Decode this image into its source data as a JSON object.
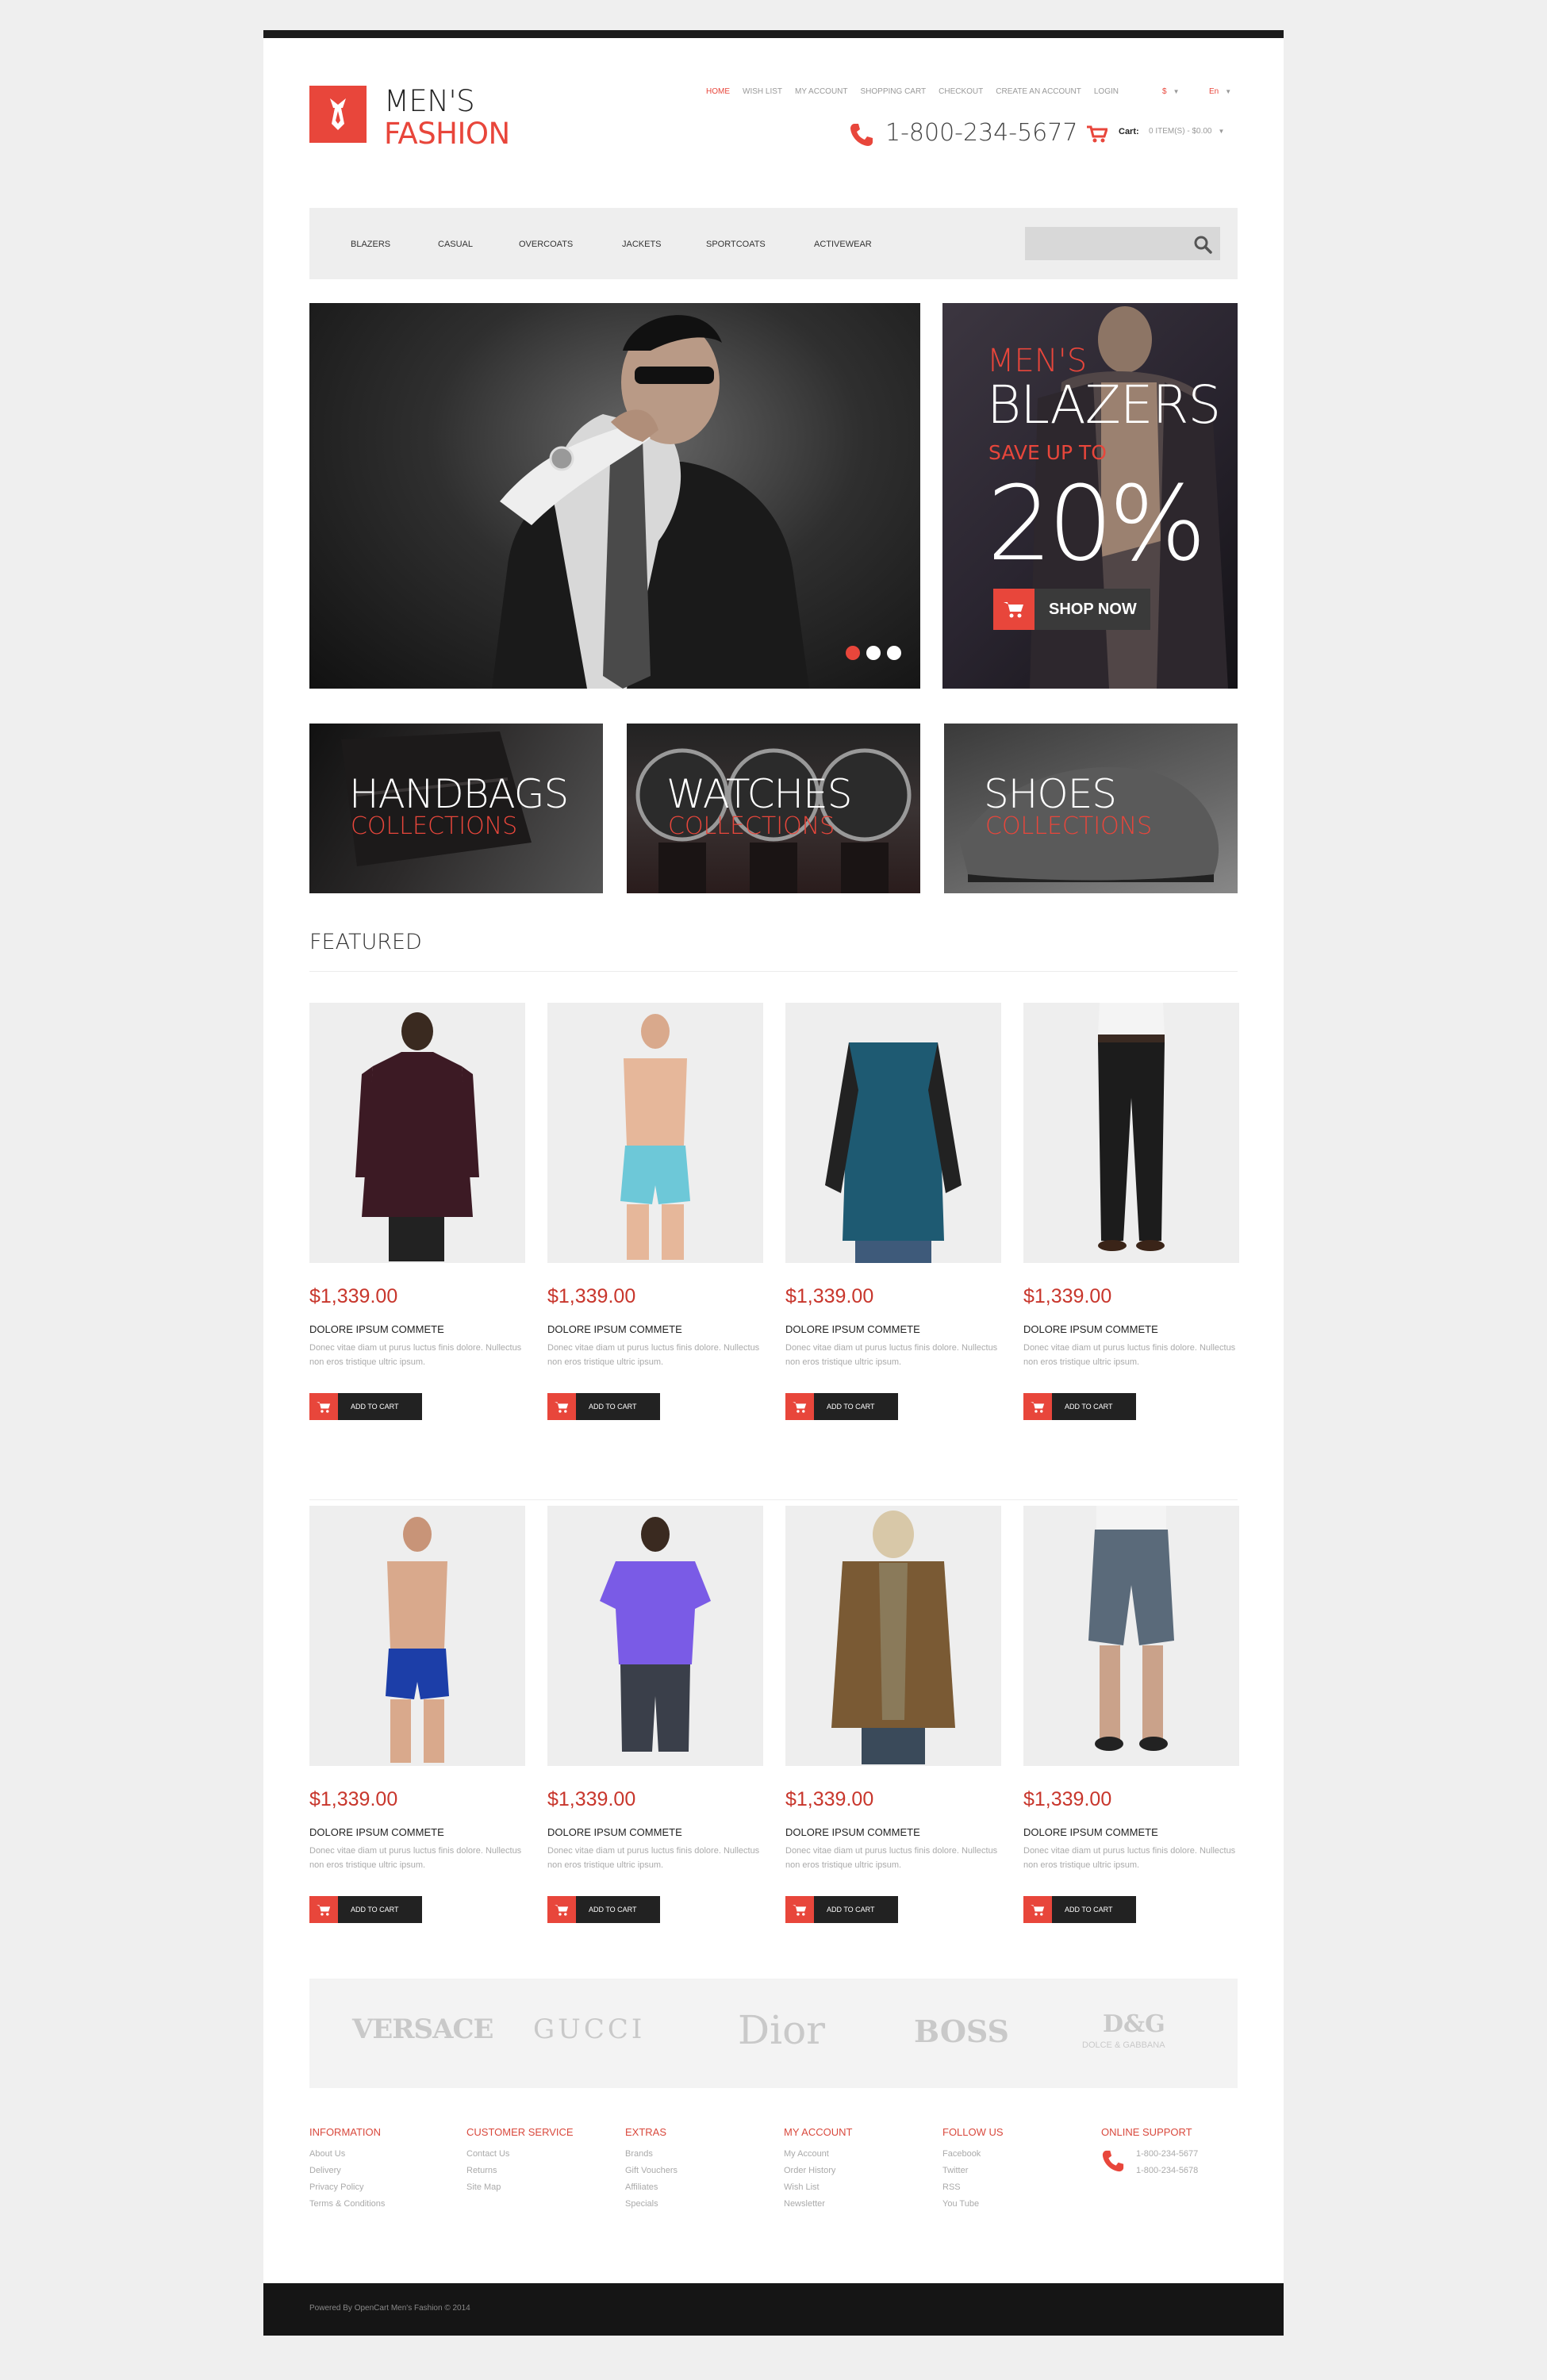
{
  "brand": {
    "line1": "MEN'S",
    "line2": "FASHION"
  },
  "top_links": [
    "HOME",
    "WISH LIST",
    "MY ACCOUNT",
    "SHOPPING CART",
    "CHECKOUT",
    "CREATE AN ACCOUNT",
    "LOGIN"
  ],
  "currency": "$",
  "language": "En",
  "phone": "1-800-234-5677",
  "cart": {
    "label": "Cart:",
    "value": "0 ITEM(S) - $0.00"
  },
  "nav": [
    "BLAZERS",
    "CASUAL",
    "OVERCOATS",
    "JACKETS",
    "SPORTCOATS",
    "ACTIVEWEAR"
  ],
  "search": {
    "placeholder": ""
  },
  "hero": {
    "slides": 3,
    "active_slide": 0
  },
  "promo": {
    "line1": "MEN'S",
    "line2": "BLAZERS",
    "line3": "SAVE UP TO",
    "percent": "20%",
    "button": "SHOP NOW"
  },
  "collections": [
    {
      "title": "HANDBAGS",
      "subtitle": "COLLECTIONS"
    },
    {
      "title": "WATCHES",
      "subtitle": "COLLECTIONS"
    },
    {
      "title": "SHOES",
      "subtitle": "COLLECTIONS"
    }
  ],
  "featured_title": "FEATURED",
  "products": [
    {
      "price": "$1,339.00",
      "name": "DOLORE IPSUM COMMETE",
      "desc": "Donec vitae diam ut purus luctus finis dolore. Nullectus non eros tristique ultric ipsum.",
      "button": "ADD TO CART"
    },
    {
      "price": "$1,339.00",
      "name": "DOLORE IPSUM COMMETE",
      "desc": "Donec vitae diam ut purus luctus finis dolore. Nullectus non eros tristique ultric ipsum.",
      "button": "ADD TO CART"
    },
    {
      "price": "$1,339.00",
      "name": "DOLORE IPSUM COMMETE",
      "desc": "Donec vitae diam ut purus luctus finis dolore. Nullectus non eros tristique ultric ipsum.",
      "button": "ADD TO CART"
    },
    {
      "price": "$1,339.00",
      "name": "DOLORE IPSUM COMMETE",
      "desc": "Donec vitae diam ut purus luctus finis dolore. Nullectus non eros tristique ultric ipsum.",
      "button": "ADD TO CART"
    },
    {
      "price": "$1,339.00",
      "name": "DOLORE IPSUM COMMETE",
      "desc": "Donec vitae diam ut purus luctus finis dolore. Nullectus non eros tristique ultric ipsum.",
      "button": "ADD TO CART"
    },
    {
      "price": "$1,339.00",
      "name": "DOLORE IPSUM COMMETE",
      "desc": "Donec vitae diam ut purus luctus finis dolore. Nullectus non eros tristique ultric ipsum.",
      "button": "ADD TO CART"
    },
    {
      "price": "$1,339.00",
      "name": "DOLORE IPSUM COMMETE",
      "desc": "Donec vitae diam ut purus luctus finis dolore. Nullectus non eros tristique ultric ipsum.",
      "button": "ADD TO CART"
    },
    {
      "price": "$1,339.00",
      "name": "DOLORE IPSUM COMMETE",
      "desc": "Donec vitae diam ut purus luctus finis dolore. Nullectus non eros tristique ultric ipsum.",
      "button": "ADD TO CART"
    }
  ],
  "brands": [
    "VERSACE",
    "GUCCI",
    "Dior",
    "BOSS",
    "D&G",
    "DOLCE & GABBANA"
  ],
  "footer": {
    "columns": [
      {
        "title": "INFORMATION",
        "links": [
          "About Us",
          "Delivery",
          "Privacy Policy",
          "Terms & Conditions"
        ]
      },
      {
        "title": "CUSTOMER SERVICE",
        "links": [
          "Contact Us",
          "Returns",
          "Site Map"
        ]
      },
      {
        "title": "EXTRAS",
        "links": [
          "Brands",
          "Gift Vouchers",
          "Affiliates",
          "Specials"
        ]
      },
      {
        "title": "MY ACCOUNT",
        "links": [
          "My Account",
          "Order History",
          "Wish List",
          "Newsletter"
        ]
      },
      {
        "title": "FOLLOW US",
        "links": [
          "Facebook",
          "Twitter",
          "RSS",
          "You Tube"
        ]
      },
      {
        "title": "ONLINE SUPPORT",
        "links": [
          "1-800-234-5677",
          "1-800-234-5678"
        ]
      }
    ],
    "powered": "Powered By OpenCart Men's Fashion © 2014"
  },
  "colors": {
    "accent": "#e8463b",
    "dark": "#1b1b1b",
    "panel": "#eeeeee"
  }
}
